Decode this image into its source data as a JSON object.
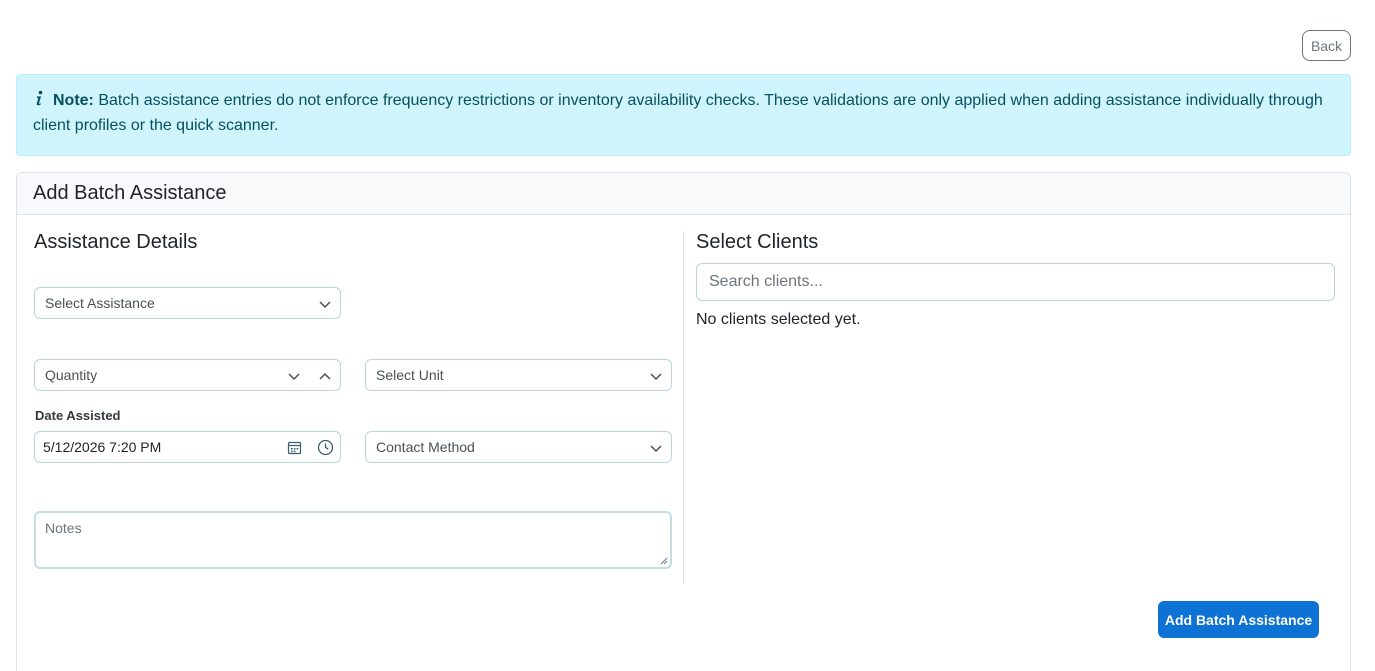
{
  "header": {
    "back_label": "Back"
  },
  "note": {
    "icon": "info-icon",
    "label": "Note:",
    "text": "Batch assistance entries do not enforce frequency restrictions or inventory availability checks. These validations are only applied when adding assistance individually through client profiles or the quick scanner."
  },
  "card": {
    "title": "Add Batch Assistance",
    "details": {
      "title": "Assistance Details",
      "assistance_select": "Select Assistance",
      "quantity_placeholder": "Quantity",
      "unit_select": "Select Unit",
      "date_label": "Date Assisted",
      "date_value": "5/12/2026 7:20 PM",
      "contact_select": "Contact Method",
      "notes_placeholder": "Notes"
    },
    "clients": {
      "title": "Select Clients",
      "search_placeholder": "Search clients...",
      "empty_text": "No clients selected yet."
    },
    "submit_label": "Add Batch Assistance"
  },
  "colors": {
    "accent": "#0d72d4",
    "note_bg": "#cff4fc",
    "note_text": "#055160"
  }
}
